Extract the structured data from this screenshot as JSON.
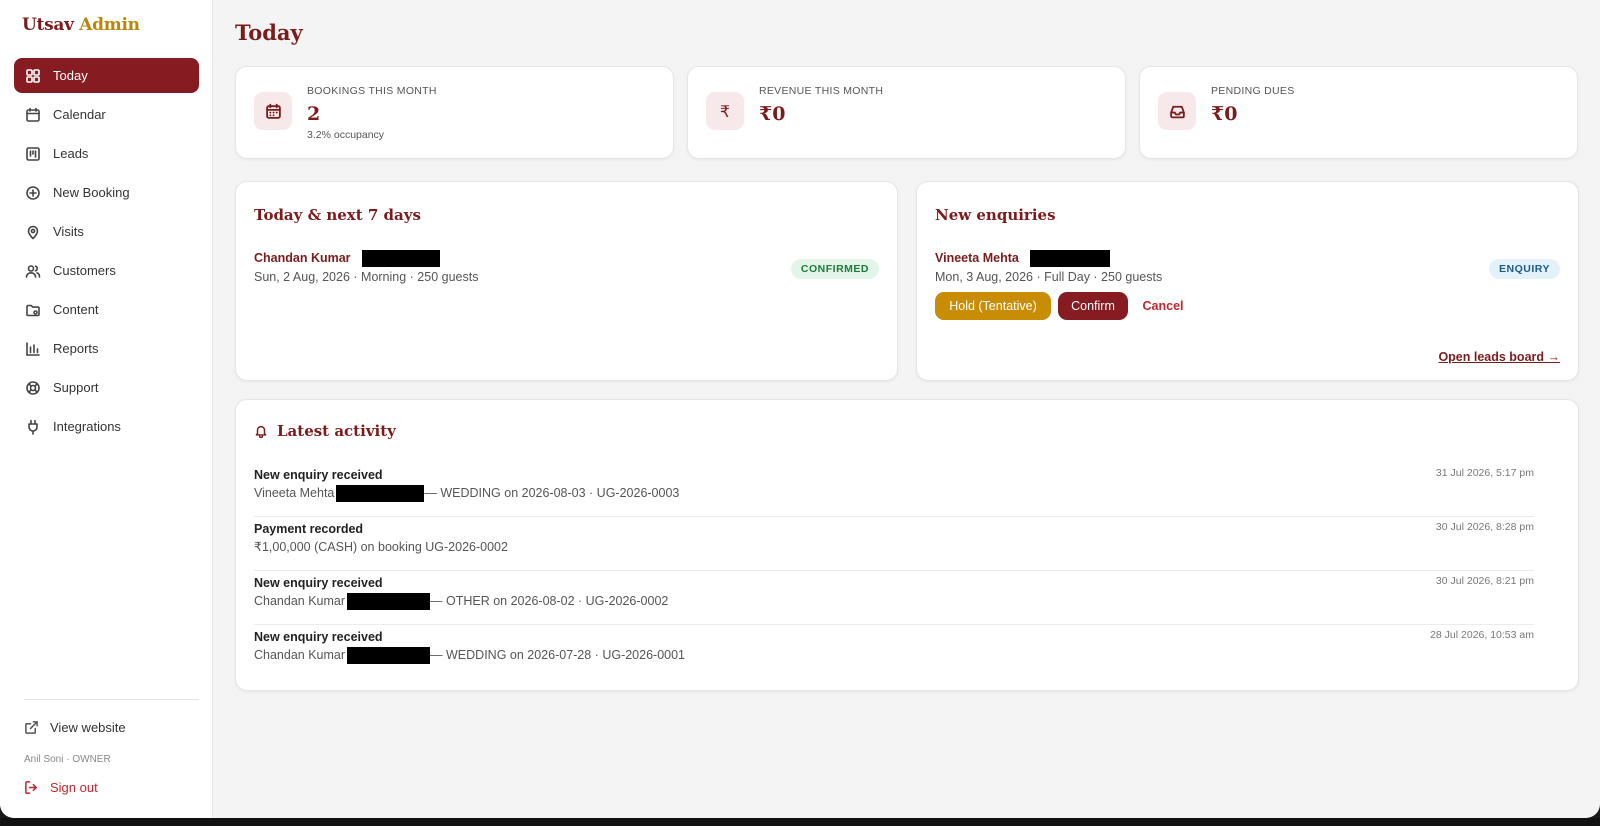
{
  "brand": {
    "part1": "Utsav",
    "part2": "Admin"
  },
  "nav": [
    {
      "label": "Today",
      "icon": "grid-icon",
      "active": true
    },
    {
      "label": "Calendar",
      "icon": "calendar-icon"
    },
    {
      "label": "Leads",
      "icon": "kanban-icon"
    },
    {
      "label": "New Booking",
      "icon": "plus-circle-icon"
    },
    {
      "label": "Visits",
      "icon": "map-pin-icon"
    },
    {
      "label": "Customers",
      "icon": "users-icon"
    },
    {
      "label": "Content",
      "icon": "folder-icon"
    },
    {
      "label": "Reports",
      "icon": "bar-chart-icon"
    },
    {
      "label": "Support",
      "icon": "lifebuoy-icon"
    },
    {
      "label": "Integrations",
      "icon": "plug-icon"
    }
  ],
  "footer": {
    "view_website": "View website",
    "user": "Anil Soni · OWNER",
    "sign_out": "Sign out"
  },
  "page_title": "Today",
  "stats": [
    {
      "label": "BOOKINGS THIS MONTH",
      "value": "2",
      "sub": "3.2% occupancy",
      "icon": "calendar-icon"
    },
    {
      "label": "REVENUE THIS MONTH",
      "value": "₹0",
      "sub": "",
      "icon": "rupee-icon"
    },
    {
      "label": "PENDING DUES",
      "value": "₹0",
      "sub": "",
      "icon": "inbox-icon"
    }
  ],
  "upcoming": {
    "title": "Today & next 7 days",
    "item": {
      "name": "Chandan Kumar",
      "meta": "Sun, 2 Aug, 2026 · Morning · 250 guests",
      "status": "CONFIRMED"
    }
  },
  "enquiries": {
    "title": "New enquiries",
    "item": {
      "name": "Vineeta Mehta",
      "meta": "Mon, 3 Aug, 2026 · Full Day · 250 guests",
      "status": "ENQUIRY"
    },
    "actions": {
      "hold": "Hold (Tentative)",
      "confirm": "Confirm",
      "cancel": "Cancel"
    },
    "link": "Open leads board →"
  },
  "activity": {
    "title": "Latest activity",
    "items": [
      {
        "title": "New enquiry received",
        "name": "Vineeta Mehta",
        "detail": "— WEDDING on 2026-08-03 · UG-2026-0003",
        "time": "31 Jul 2026, 5:17 pm",
        "redacted": true
      },
      {
        "title": "Payment recorded",
        "name": "",
        "detail": "₹1,00,000 (CASH) on booking UG-2026-0002",
        "time": "30 Jul 2026, 8:28 pm",
        "redacted": false
      },
      {
        "title": "New enquiry received",
        "name": "Chandan Kumar",
        "detail": "— OTHER on 2026-08-02 · UG-2026-0002",
        "time": "30 Jul 2026, 8:21 pm",
        "redacted": true
      },
      {
        "title": "New enquiry received",
        "name": "Chandan Kumar",
        "detail": "— WEDDING on 2026-07-28 · UG-2026-0001",
        "time": "28 Jul 2026, 10:53 am",
        "redacted": true
      }
    ]
  }
}
